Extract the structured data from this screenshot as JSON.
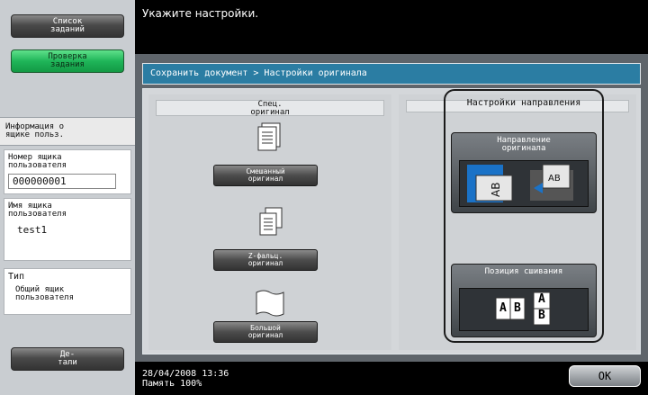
{
  "left": {
    "btn_jobs": [
      "Список",
      "заданий"
    ],
    "btn_check": [
      "Проверка",
      "задания"
    ],
    "info_header": [
      "Информация о",
      "ящике польз."
    ],
    "user_box_no_label": [
      "Номер ящика",
      "пользователя"
    ],
    "user_box_no_value": "000000001",
    "user_box_name_label": [
      "Имя ящика",
      "пользователя"
    ],
    "user_box_name_value": "test1",
    "type_label": "Тип",
    "type_value": [
      "Общий ящик",
      "пользователя"
    ],
    "details_btn": [
      "Де-",
      "тали"
    ]
  },
  "top": {
    "message": "Укажите настройки."
  },
  "main": {
    "breadcrumb": "Сохранить документ > Настройки оригинала",
    "special_header": [
      "Спец.",
      "оригинал"
    ],
    "mixed_btn": [
      "Смешанный",
      "оригинал"
    ],
    "zfold_btn": [
      "Z-фальц.",
      "оригинал"
    ],
    "large_btn": [
      "Большой",
      "оригинал"
    ],
    "direction_header": "Настройки направления",
    "orig_dir_btn": [
      "Направление",
      "оригинала"
    ],
    "bind_pos_btn": "Позиция сшивания",
    "bind_ab": [
      "A",
      "B",
      "A",
      "B"
    ]
  },
  "bottom": {
    "date_time": "28/04/2008   13:36",
    "memory": "Память      100%",
    "ok": "OK"
  }
}
